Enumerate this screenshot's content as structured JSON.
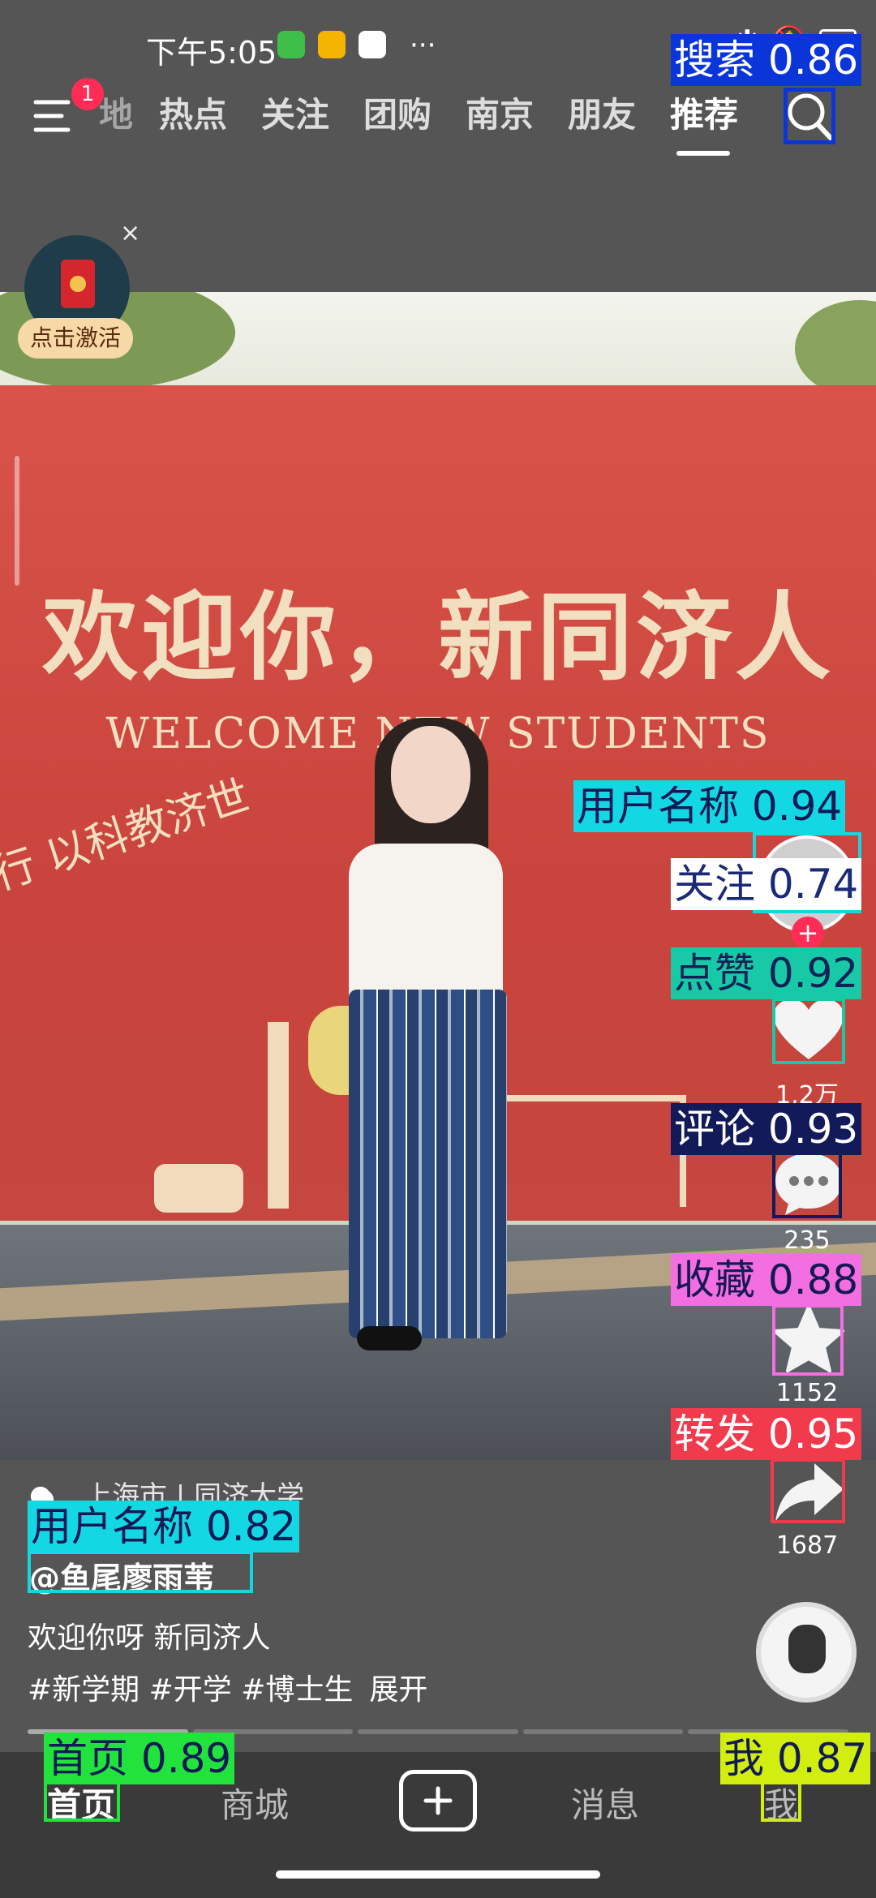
{
  "status_bar": {
    "time": "下午5:05",
    "more": "···"
  },
  "top_tabs": {
    "partial_first": "地",
    "items": [
      "热点",
      "关注",
      "团购",
      "南京",
      "朋友",
      "推荐"
    ],
    "active": "推荐",
    "menu_badge": "1"
  },
  "red_packet": {
    "label": "点击激活",
    "close": "×"
  },
  "video": {
    "banner_cn": "欢迎你，新同济人",
    "banner_en": "WELCOME NEW STUDENTS",
    "slogan": "行  以科教济世"
  },
  "actions": {
    "like_count": "1.2万",
    "comment_count": "235",
    "collect_count": "1152",
    "share_count": "1687"
  },
  "post": {
    "location": "上海市 | 同济大学",
    "username": "@鱼尾廖雨苇",
    "caption": "欢迎你呀 新同济人",
    "tags": "#新学期 #开学 #博士生",
    "expand": "展开"
  },
  "bottom_nav": {
    "home": "首页",
    "mall": "商城",
    "messages": "消息",
    "me": "我"
  },
  "detections": [
    {
      "label": "搜索 0.86",
      "color": "#0a35d9",
      "text_color": "#ffffff"
    },
    {
      "label": "用户名称 0.94",
      "color": "#14d7e4",
      "text_color": "#111a55"
    },
    {
      "label": "关注 0.74",
      "color": "#ffffff",
      "text_color": "#1a2a77"
    },
    {
      "label": "点赞 0.92",
      "color": "#18c9a8",
      "text_color": "#112255"
    },
    {
      "label": "评论 0.93",
      "color": "#121a5a",
      "text_color": "#ffffff"
    },
    {
      "label": "收藏 0.88",
      "color": "#f36ee0",
      "text_color": "#151a55"
    },
    {
      "label": "转发 0.95",
      "color": "#f23a4d",
      "text_color": "#ffffff"
    },
    {
      "label": "用户名称 0.82",
      "color": "#14d7e4",
      "text_color": "#111a55"
    },
    {
      "label": "首页 0.89",
      "color": "#22e33c",
      "text_color": "#111a55"
    },
    {
      "label": "我 0.87",
      "color": "#d2ee10",
      "text_color": "#111a55"
    }
  ]
}
